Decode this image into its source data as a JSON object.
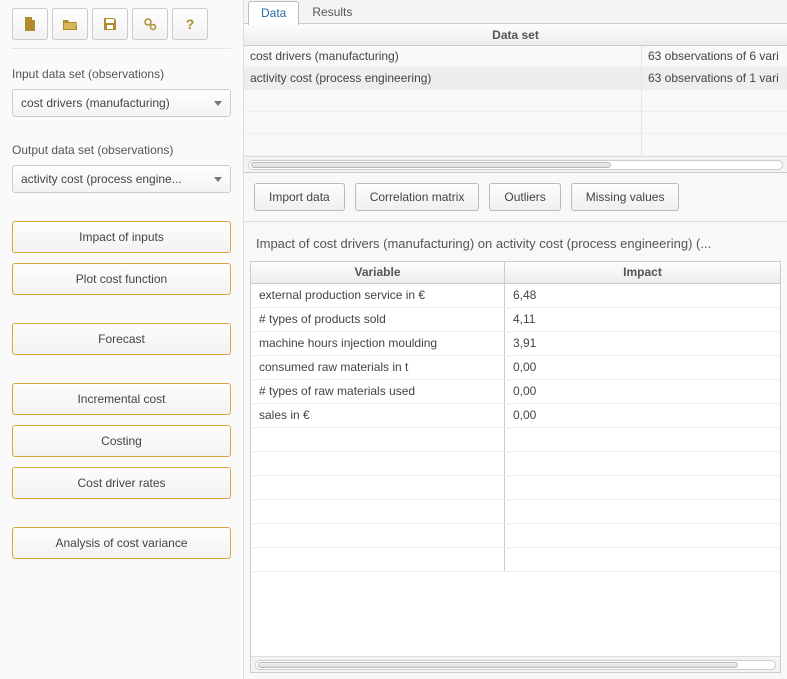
{
  "sidebar": {
    "input_label": "Input data set (observations)",
    "input_value": "cost drivers (manufacturing)",
    "output_label": "Output data set (observations)",
    "output_value": "activity cost (process engine...",
    "btn_impact": "Impact of inputs",
    "btn_plot": "Plot cost function",
    "btn_forecast": "Forecast",
    "btn_incremental": "Incremental cost",
    "btn_costing": "Costing",
    "btn_rates": "Cost driver rates",
    "btn_variance": "Analysis of cost variance"
  },
  "tabs": {
    "data": "Data",
    "results": "Results"
  },
  "datasets": {
    "header": "Data set",
    "rows": [
      {
        "name": "cost drivers (manufacturing)",
        "obs": "63 observations of 6 vari"
      },
      {
        "name": "activity cost (process engineering)",
        "obs": "63 observations of 1 vari"
      }
    ]
  },
  "buttons": {
    "import": "Import data",
    "corr": "Correlation matrix",
    "outliers": "Outliers",
    "missing": "Missing values"
  },
  "impact": {
    "title": "Impact of cost drivers (manufacturing) on activity cost (process engineering) (...",
    "col_variable": "Variable",
    "col_impact": "Impact",
    "rows": [
      {
        "variable": "external production service in €",
        "impact": "6,48"
      },
      {
        "variable": "# types of products sold",
        "impact": "4,11"
      },
      {
        "variable": "machine hours injection moulding",
        "impact": "3,91"
      },
      {
        "variable": "consumed raw materials in t",
        "impact": "0,00"
      },
      {
        "variable": "# types of raw materials used",
        "impact": "0,00"
      },
      {
        "variable": "sales in €",
        "impact": "0,00"
      }
    ]
  }
}
